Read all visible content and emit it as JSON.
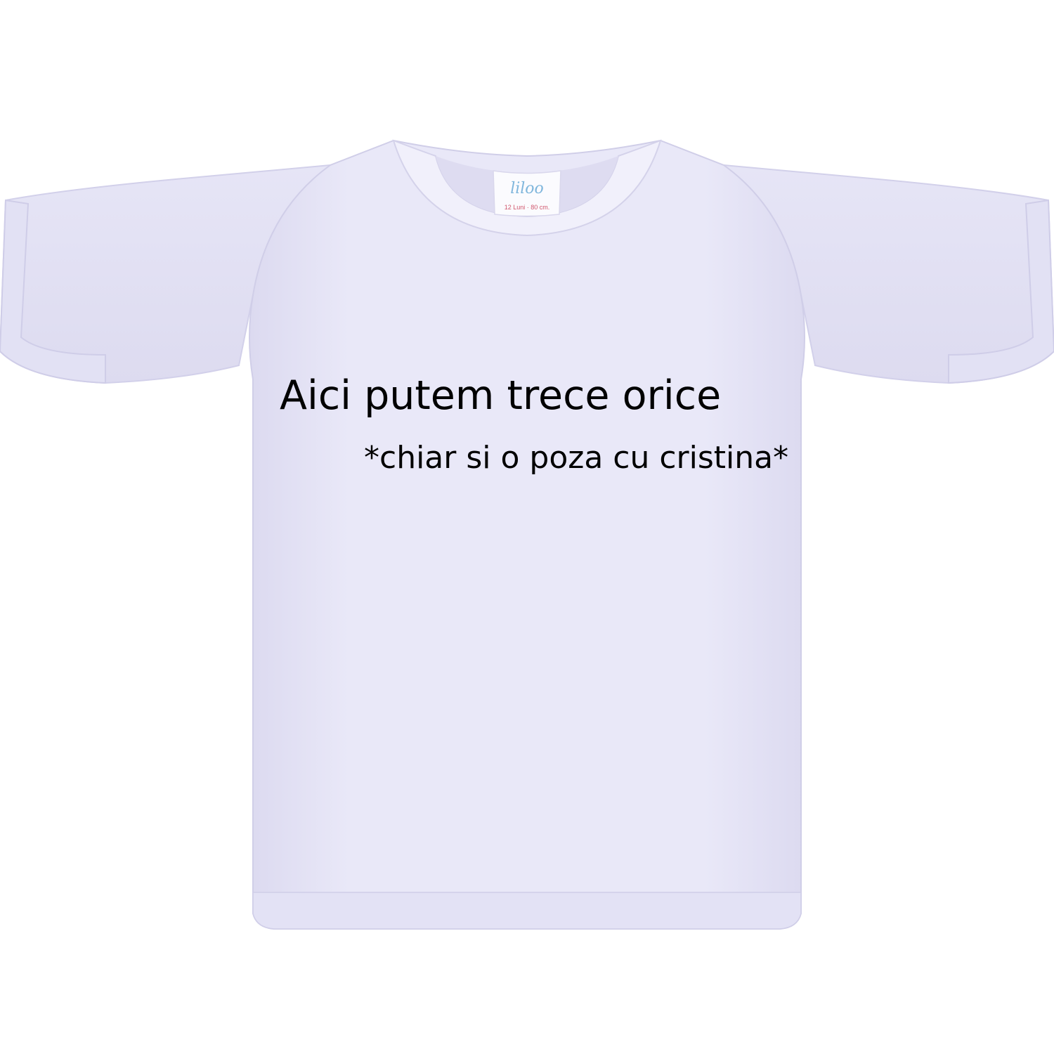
{
  "product": {
    "label": {
      "brand": "liloo",
      "size": "12 Luni · 80 cm."
    },
    "print": {
      "main_text": "Aici putem trece orice",
      "sub_text": "*chiar si o poza cu cristina*"
    }
  },
  "colors": {
    "background": "#ffffff",
    "shirt": "#e9e8f8",
    "shirt_shadow": "#d8d6ee",
    "print_text": "#000000",
    "brand_blue": "#7fb6dc",
    "label_red": "#d0566d"
  }
}
